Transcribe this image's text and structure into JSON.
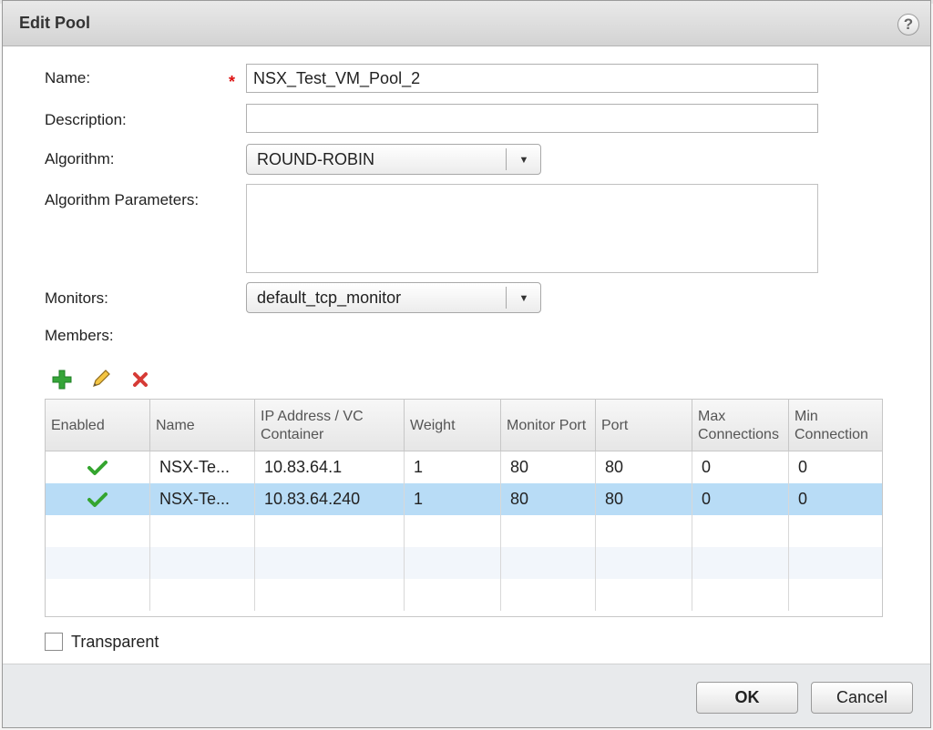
{
  "dialog": {
    "title": "Edit Pool",
    "help_label": "?"
  },
  "form": {
    "name_label": "Name:",
    "required_mark": "*",
    "name_value": "NSX_Test_VM_Pool_2",
    "description_label": "Description:",
    "description_value": "",
    "algorithm_label": "Algorithm:",
    "algorithm_value": "ROUND-ROBIN",
    "algorithm_parameters_label": "Algorithm Parameters:",
    "algorithm_parameters_value": "",
    "monitors_label": "Monitors:",
    "monitors_value": "default_tcp_monitor",
    "members_label": "Members:"
  },
  "toolbar": {
    "add_icon": "add-icon",
    "edit_icon": "pencil-icon",
    "delete_icon": "delete-icon"
  },
  "members_table": {
    "columns": [
      "Enabled",
      "Name",
      "IP Address / VC Container",
      "Weight",
      "Monitor Port",
      "Port",
      "Max Connections",
      "Min Connection"
    ],
    "rows": [
      {
        "enabled": true,
        "name": "NSX-Te...",
        "ip": "10.83.64.1",
        "weight": "1",
        "monitor_port": "80",
        "port": "80",
        "max_connections": "0",
        "min_connection": "0"
      },
      {
        "enabled": true,
        "name": "NSX-Te...",
        "ip": "10.83.64.240",
        "weight": "1",
        "monitor_port": "80",
        "port": "80",
        "max_connections": "0",
        "min_connection": "0"
      }
    ]
  },
  "options": {
    "transparent_label": "Transparent",
    "transparent_checked": false
  },
  "buttons": {
    "ok": "OK",
    "cancel": "Cancel"
  },
  "colors": {
    "selected_row": "#b8dcf6",
    "check_green": "#34a52f",
    "required_red": "#dd1111",
    "add_green": "#36a539",
    "delete_red": "#d63b36"
  }
}
